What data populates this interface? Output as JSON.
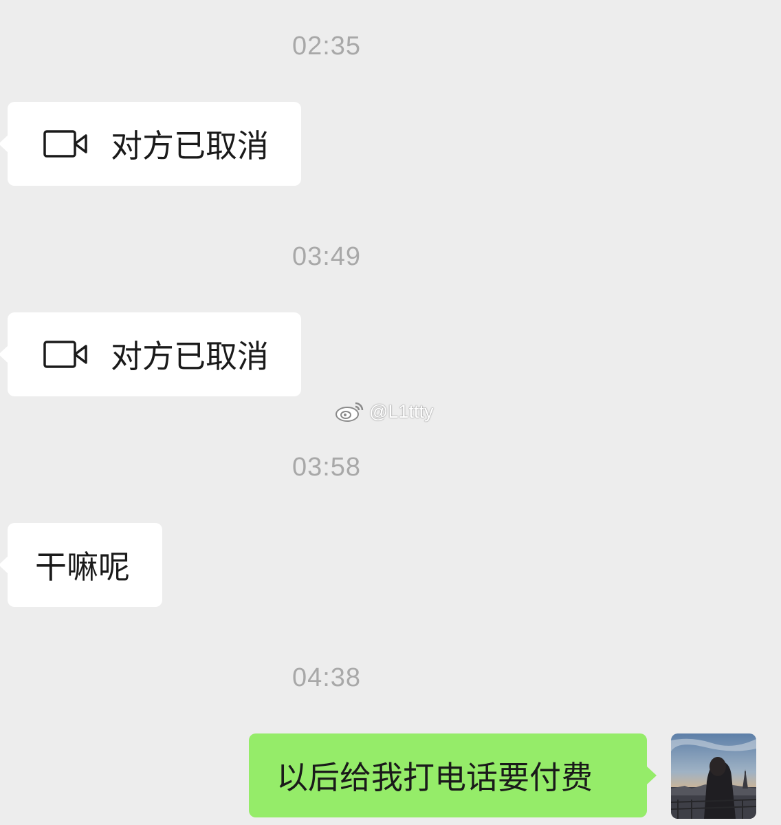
{
  "messages": [
    {
      "time": "02:35",
      "text": "对方已取消",
      "icon": "video-camera-icon"
    },
    {
      "time": "03:49",
      "text": "对方已取消",
      "icon": "video-camera-icon"
    },
    {
      "time": "03:58",
      "text": "干嘛呢"
    },
    {
      "time": "04:38",
      "text": "以后给我打电话要付费"
    }
  ],
  "watermark": {
    "handle": "@L1ttty",
    "icon": "weibo-logo"
  },
  "colors": {
    "background": "#ededed",
    "incoming_bubble": "#ffffff",
    "outgoing_bubble": "#95ec69",
    "timestamp": "#a8a8a8"
  }
}
